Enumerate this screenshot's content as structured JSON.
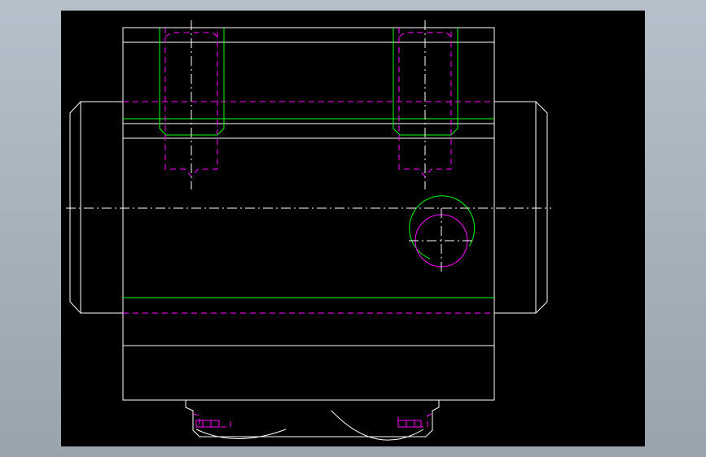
{
  "viewer": {
    "background_color": "#000000",
    "frame_color": "#a8b2bc"
  },
  "drawing": {
    "layers": [
      {
        "name": "outline",
        "color": "#ffffff"
      },
      {
        "name": "thread",
        "color": "#00ff00"
      },
      {
        "name": "hidden",
        "color": "#ff00ff"
      },
      {
        "name": "center",
        "color": "#ffffff"
      }
    ]
  }
}
